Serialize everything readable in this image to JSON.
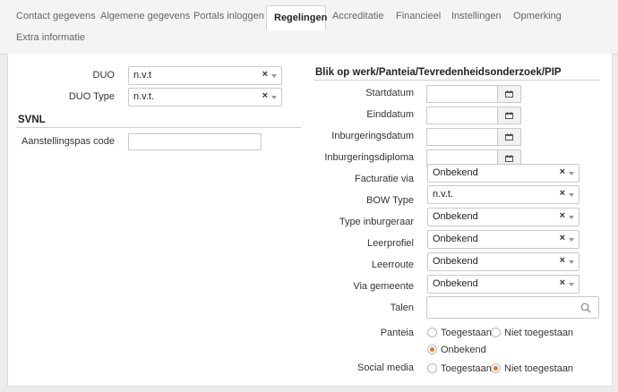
{
  "tabs": [
    {
      "label": "Contact gegevens"
    },
    {
      "label": "Algemene gegevens"
    },
    {
      "label": "Portals inloggen"
    },
    {
      "label": "Regelingen"
    },
    {
      "label": "Accreditatie"
    },
    {
      "label": "Financieel"
    },
    {
      "label": "Instellingen"
    },
    {
      "label": "Opmerking"
    },
    {
      "label": "Extra informatie"
    }
  ],
  "active_tab": "Regelingen",
  "left": {
    "duo_label": "DUO",
    "duo_value": "n.v.t",
    "duo_type_label": "DUO Type",
    "duo_type_value": "n.v.t.",
    "svnl_title": "SVNL",
    "aanstellingspas_label": "Aanstellingspas code",
    "aanstellingspas_value": ""
  },
  "right": {
    "section_title": "Blik op werk/Panteia/Tevredenheidsonderzoek/PIP",
    "startdatum_label": "Startdatum",
    "einddatum_label": "Einddatum",
    "inburgeringsdatum_label": "Inburgeringsdatum",
    "inburgeringsdiploma_label": "Inburgeringsdiploma",
    "facturatie_label": "Facturatie via",
    "facturatie_value": "Onbekend",
    "bow_type_label": "BOW Type",
    "bow_type_value": "n.v.t.",
    "type_inburgeraar_label": "Type inburgeraar",
    "type_inburgeraar_value": "Onbekend",
    "leerprofiel_label": "Leerprofiel",
    "leerprofiel_value": "Onbekend",
    "leerroute_label": "Leerroute",
    "leerroute_value": "Onbekend",
    "via_gemeente_label": "Via gemeente",
    "via_gemeente_value": "Onbekend",
    "talen_label": "Talen",
    "panteia_label": "Panteia",
    "panteia_options": [
      "Toegestaan",
      "Niet toegestaan",
      "Onbekend"
    ],
    "panteia_selected": "Onbekend",
    "social_media_label": "Social media",
    "social_media_options": [
      "Toegestaan",
      "Niet toegestaan"
    ],
    "social_media_selected": "Niet toegestaan"
  },
  "icons": {
    "clear": "×",
    "calendar": "calendar-icon",
    "search": "search-icon",
    "caret": "chevron-down-icon"
  },
  "colors": {
    "accent": "#e8712b"
  }
}
